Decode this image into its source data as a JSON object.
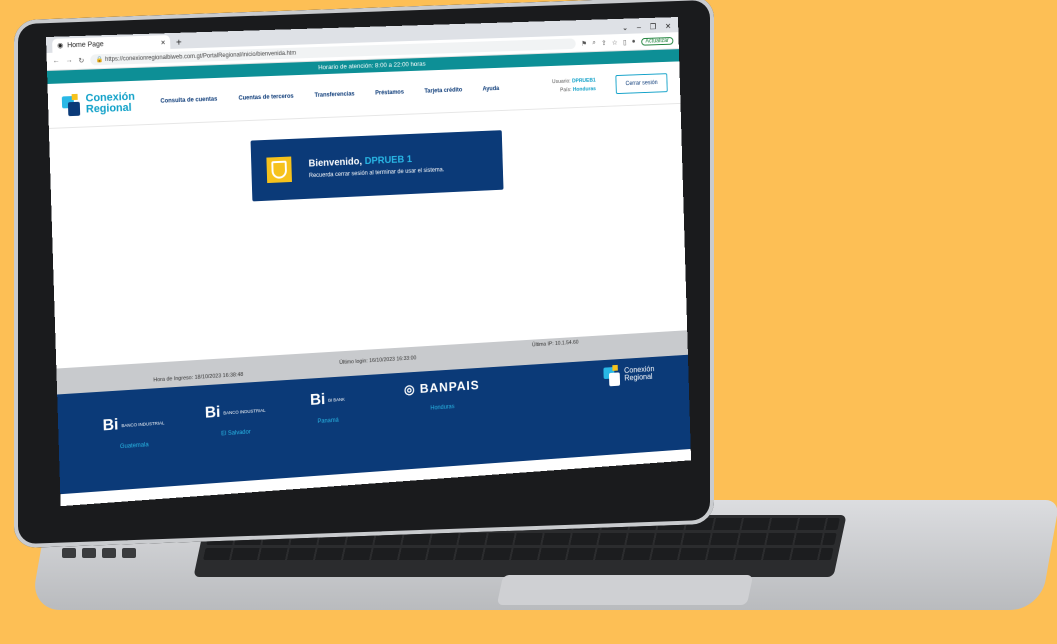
{
  "browser": {
    "tab_title": "Home Page",
    "url": "https://conexionregionalbiweb.com.gt/PortalRegional/inicio/bienvenida.htm",
    "update_label": "Actualizar"
  },
  "site": {
    "hours_banner": "Horario de atención: 8:00 a 22:00 horas",
    "logo_line1": "Conexión",
    "logo_line2": "Regional",
    "nav": [
      "Consulta de cuentas",
      "Cuentas de terceros",
      "Transferencias",
      "Préstamos",
      "Tarjeta crédito",
      "Ayuda"
    ],
    "user_label": "Usuario:",
    "user_value": "DPRUEB1",
    "country_label": "País:",
    "country_value": "Honduras",
    "logout": "Cerrar sesión"
  },
  "welcome": {
    "greeting": "Bienvenido,",
    "name": "DPRUEB 1",
    "message": "Recuerda cerrar sesión al terminar de usar el sistema."
  },
  "status": {
    "login_time": "Hora de Ingreso: 18/10/2023 16:38:48",
    "last_login": "Último login: 16/10/2023 16:33:00",
    "last_ip": "Última IP: 10.1.54.60"
  },
  "footer": {
    "banks": [
      {
        "name": "Bi",
        "sub": "BANCO INDUSTRIAL",
        "country": "Guatemala"
      },
      {
        "name": "Bi",
        "sub": "BANCO INDUSTRIAL",
        "country": "El Salvador"
      },
      {
        "name": "Bi",
        "sub": "BI BANK",
        "country": "Panamá"
      },
      {
        "name": "BANPAIS",
        "sub": "",
        "country": "Honduras"
      }
    ],
    "brand_line1": "Conexión",
    "brand_line2": "Regional"
  },
  "colors": {
    "navy": "#0b3a78",
    "cyan": "#29b8e6",
    "teal": "#0d8f96",
    "yellow": "#f6c21c",
    "background": "#fdbf55"
  }
}
